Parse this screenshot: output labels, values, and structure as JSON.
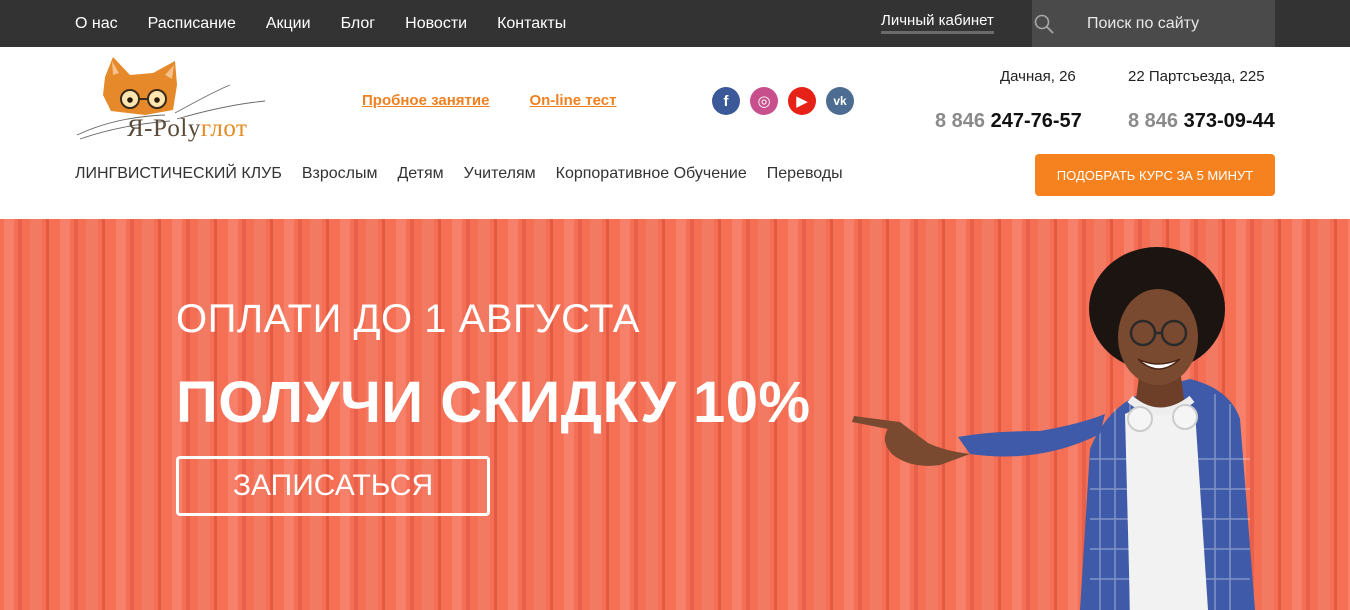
{
  "topnav": {
    "items": [
      "О нас",
      "Расписание",
      "Акции",
      "Блог",
      "Новости",
      "Контакты"
    ],
    "cabinet": "Личный кабинет",
    "search_placeholder": "Поиск по сайту"
  },
  "logo": {
    "text_prefix": "Я-Poly",
    "text_suffix": "глот"
  },
  "header": {
    "links": [
      "Пробное занятие",
      "On-line тест"
    ],
    "social_icons": [
      "facebook-icon",
      "instagram-icon",
      "youtube-icon",
      "vk-icon"
    ],
    "social_glyphs": [
      "f",
      "◎",
      "▶",
      "vk"
    ],
    "locations": [
      {
        "address": "Дачная, 26",
        "phone_code": "8 846",
        "phone_number": "247-76-57"
      },
      {
        "address": "22 Партсъезда, 225",
        "phone_code": "8 846",
        "phone_number": "373-09-44"
      }
    ]
  },
  "mainnav": {
    "items": [
      "ЛИНГВИСТИЧЕСКИЙ КЛУБ",
      "Взрослым",
      "Детям",
      "Учителям",
      "Корпоративное Обучение",
      "Переводы"
    ],
    "cta": "ПОДОБРАТЬ КУРС ЗА 5 МИНУТ"
  },
  "hero": {
    "line1": "ОПЛАТИ ДО 1 АВГУСТА",
    "line2": "ПОЛУЧИ СКИДКУ 10%",
    "button": "ЗАПИСАТЬСЯ"
  },
  "colors": {
    "topbar": "#333333",
    "accent": "#f5821f",
    "hero": "#f56f55",
    "link": "#f08020"
  }
}
